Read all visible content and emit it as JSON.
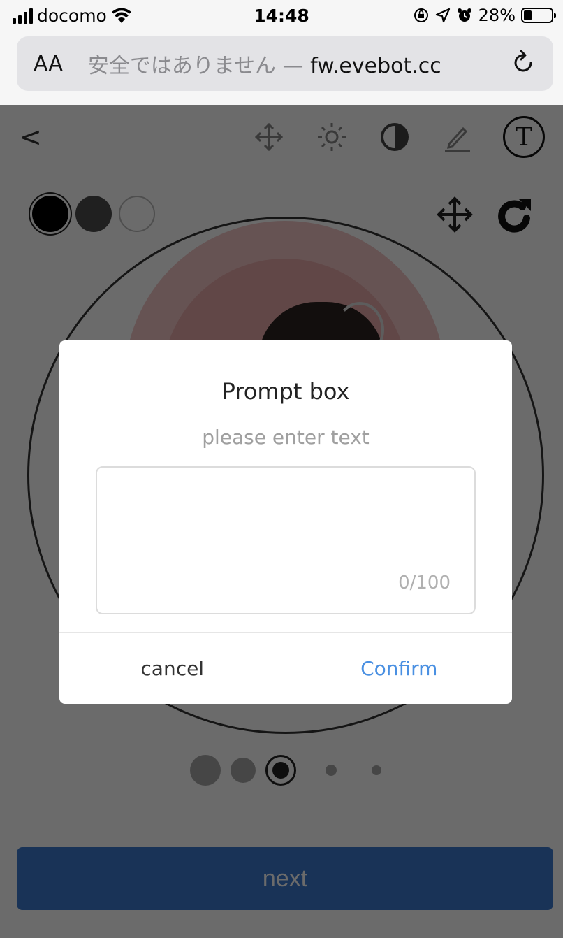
{
  "status_bar": {
    "carrier": "docomo",
    "time": "14:48",
    "battery": "28%",
    "battery_level": 0.28
  },
  "browser": {
    "aa_label": "AA",
    "url_prefix": "安全ではありません — ",
    "url_domain": "fw.evebot.cc"
  },
  "app": {
    "back_label": "<",
    "text_tool_label": "T",
    "color_swatches": [
      "#000000",
      "#4c4c4c",
      "#ffffff"
    ],
    "next_label": "next",
    "step_indicator": {
      "total": 5,
      "current": 3
    }
  },
  "dialog": {
    "title": "Prompt box",
    "subtitle": "please enter text",
    "input_value": "",
    "counter": "0/100",
    "cancel_label": "cancel",
    "confirm_label": "Confirm"
  },
  "colors": {
    "accent": "#4a90e2",
    "next_button": "#3d7bd0"
  }
}
